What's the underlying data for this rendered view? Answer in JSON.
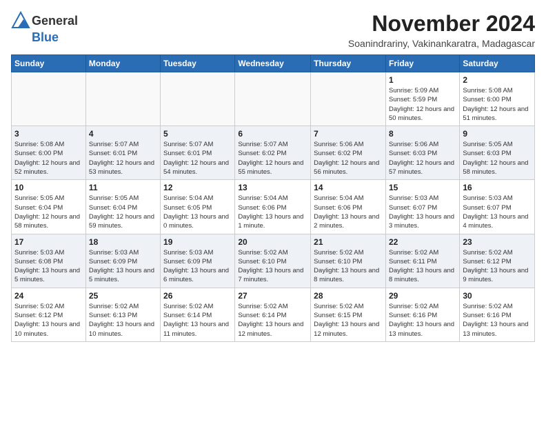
{
  "logo": {
    "general": "General",
    "blue": "Blue"
  },
  "title": "November 2024",
  "location": "Soanindrariny, Vakinankaratra, Madagascar",
  "days_of_week": [
    "Sunday",
    "Monday",
    "Tuesday",
    "Wednesday",
    "Thursday",
    "Friday",
    "Saturday"
  ],
  "weeks": [
    {
      "shaded": false,
      "days": [
        {
          "date": "",
          "info": ""
        },
        {
          "date": "",
          "info": ""
        },
        {
          "date": "",
          "info": ""
        },
        {
          "date": "",
          "info": ""
        },
        {
          "date": "",
          "info": ""
        },
        {
          "date": "1",
          "info": "Sunrise: 5:09 AM\nSunset: 5:59 PM\nDaylight: 12 hours and 50 minutes."
        },
        {
          "date": "2",
          "info": "Sunrise: 5:08 AM\nSunset: 6:00 PM\nDaylight: 12 hours and 51 minutes."
        }
      ]
    },
    {
      "shaded": true,
      "days": [
        {
          "date": "3",
          "info": "Sunrise: 5:08 AM\nSunset: 6:00 PM\nDaylight: 12 hours and 52 minutes."
        },
        {
          "date": "4",
          "info": "Sunrise: 5:07 AM\nSunset: 6:01 PM\nDaylight: 12 hours and 53 minutes."
        },
        {
          "date": "5",
          "info": "Sunrise: 5:07 AM\nSunset: 6:01 PM\nDaylight: 12 hours and 54 minutes."
        },
        {
          "date": "6",
          "info": "Sunrise: 5:07 AM\nSunset: 6:02 PM\nDaylight: 12 hours and 55 minutes."
        },
        {
          "date": "7",
          "info": "Sunrise: 5:06 AM\nSunset: 6:02 PM\nDaylight: 12 hours and 56 minutes."
        },
        {
          "date": "8",
          "info": "Sunrise: 5:06 AM\nSunset: 6:03 PM\nDaylight: 12 hours and 57 minutes."
        },
        {
          "date": "9",
          "info": "Sunrise: 5:05 AM\nSunset: 6:03 PM\nDaylight: 12 hours and 58 minutes."
        }
      ]
    },
    {
      "shaded": false,
      "days": [
        {
          "date": "10",
          "info": "Sunrise: 5:05 AM\nSunset: 6:04 PM\nDaylight: 12 hours and 58 minutes."
        },
        {
          "date": "11",
          "info": "Sunrise: 5:05 AM\nSunset: 6:04 PM\nDaylight: 12 hours and 59 minutes."
        },
        {
          "date": "12",
          "info": "Sunrise: 5:04 AM\nSunset: 6:05 PM\nDaylight: 13 hours and 0 minutes."
        },
        {
          "date": "13",
          "info": "Sunrise: 5:04 AM\nSunset: 6:06 PM\nDaylight: 13 hours and 1 minute."
        },
        {
          "date": "14",
          "info": "Sunrise: 5:04 AM\nSunset: 6:06 PM\nDaylight: 13 hours and 2 minutes."
        },
        {
          "date": "15",
          "info": "Sunrise: 5:03 AM\nSunset: 6:07 PM\nDaylight: 13 hours and 3 minutes."
        },
        {
          "date": "16",
          "info": "Sunrise: 5:03 AM\nSunset: 6:07 PM\nDaylight: 13 hours and 4 minutes."
        }
      ]
    },
    {
      "shaded": true,
      "days": [
        {
          "date": "17",
          "info": "Sunrise: 5:03 AM\nSunset: 6:08 PM\nDaylight: 13 hours and 5 minutes."
        },
        {
          "date": "18",
          "info": "Sunrise: 5:03 AM\nSunset: 6:09 PM\nDaylight: 13 hours and 5 minutes."
        },
        {
          "date": "19",
          "info": "Sunrise: 5:03 AM\nSunset: 6:09 PM\nDaylight: 13 hours and 6 minutes."
        },
        {
          "date": "20",
          "info": "Sunrise: 5:02 AM\nSunset: 6:10 PM\nDaylight: 13 hours and 7 minutes."
        },
        {
          "date": "21",
          "info": "Sunrise: 5:02 AM\nSunset: 6:10 PM\nDaylight: 13 hours and 8 minutes."
        },
        {
          "date": "22",
          "info": "Sunrise: 5:02 AM\nSunset: 6:11 PM\nDaylight: 13 hours and 8 minutes."
        },
        {
          "date": "23",
          "info": "Sunrise: 5:02 AM\nSunset: 6:12 PM\nDaylight: 13 hours and 9 minutes."
        }
      ]
    },
    {
      "shaded": false,
      "days": [
        {
          "date": "24",
          "info": "Sunrise: 5:02 AM\nSunset: 6:12 PM\nDaylight: 13 hours and 10 minutes."
        },
        {
          "date": "25",
          "info": "Sunrise: 5:02 AM\nSunset: 6:13 PM\nDaylight: 13 hours and 10 minutes."
        },
        {
          "date": "26",
          "info": "Sunrise: 5:02 AM\nSunset: 6:14 PM\nDaylight: 13 hours and 11 minutes."
        },
        {
          "date": "27",
          "info": "Sunrise: 5:02 AM\nSunset: 6:14 PM\nDaylight: 13 hours and 12 minutes."
        },
        {
          "date": "28",
          "info": "Sunrise: 5:02 AM\nSunset: 6:15 PM\nDaylight: 13 hours and 12 minutes."
        },
        {
          "date": "29",
          "info": "Sunrise: 5:02 AM\nSunset: 6:16 PM\nDaylight: 13 hours and 13 minutes."
        },
        {
          "date": "30",
          "info": "Sunrise: 5:02 AM\nSunset: 6:16 PM\nDaylight: 13 hours and 13 minutes."
        }
      ]
    }
  ]
}
